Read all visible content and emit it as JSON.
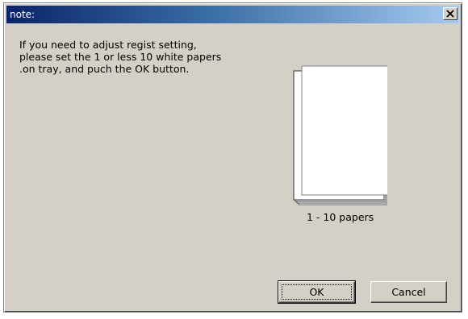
{
  "window": {
    "title": "note:",
    "close_icon": "close-icon"
  },
  "message": {
    "lines": [
      "If you need to adjust regist setting,",
      "please set the 1 or less 10 white papers",
      ".on tray, and puch the OK button."
    ]
  },
  "illustration": {
    "icon": "paper-stack-icon",
    "caption": "1 - 10 papers"
  },
  "buttons": {
    "ok_label": "OK",
    "cancel_label": "Cancel"
  },
  "colors": {
    "titlebar_start": "#0a246a",
    "titlebar_end": "#a6caf0",
    "dialog_bg": "#d4d0c8"
  }
}
